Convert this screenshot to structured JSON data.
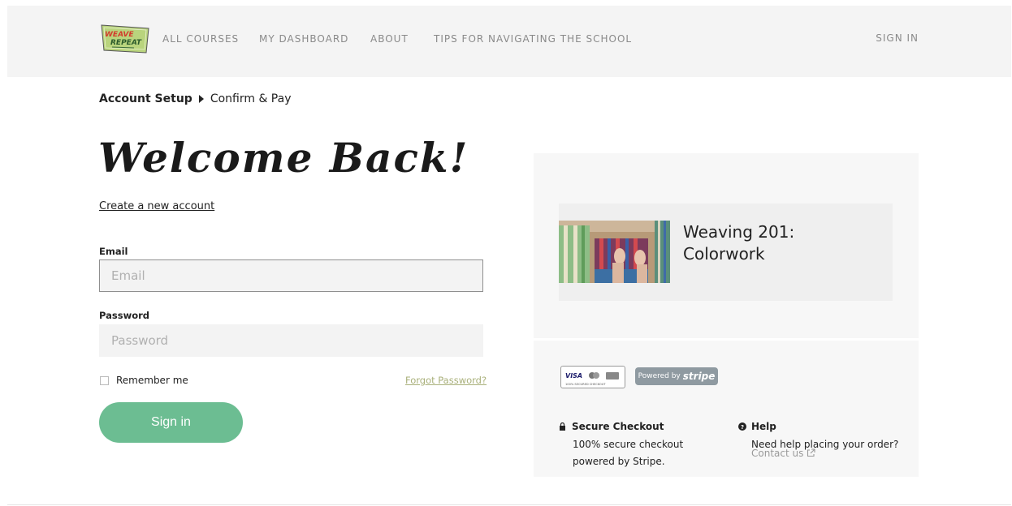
{
  "header": {
    "logo_top": "WEAVE",
    "logo_bottom": "REPEAT",
    "nav": [
      "ALL COURSES",
      "MY DASHBOARD",
      "ABOUT",
      "TIPS FOR NAVIGATING THE SCHOOL"
    ],
    "sign_in": "SIGN IN"
  },
  "breadcrumb": {
    "step1": "Account Setup",
    "step2": "Confirm & Pay"
  },
  "login": {
    "heading": "Welcome Back!",
    "create_account": "Create a new account",
    "email_label": "Email",
    "email_placeholder": "Email",
    "password_label": "Password",
    "password_placeholder": "Password",
    "remember_label": "Remember me",
    "forgot_label": "Forgot Password?",
    "submit_label": "Sign in"
  },
  "course": {
    "title": "Weaving 201: Colorwork"
  },
  "payment": {
    "badge_text": "100% SECURED CHECKOUT",
    "badge_visa": "VISA",
    "stripe_prefix": "Powered by",
    "stripe_brand": "stripe",
    "secure_title": "Secure Checkout",
    "secure_text": "100% secure checkout powered by Stripe.",
    "help_title": "Help",
    "help_text": "Need help placing your order?",
    "contact_label": "Contact us"
  },
  "colors": {
    "accent": "#6cbd92",
    "forgot_link": "#a9b07a",
    "topbar_bg": "#f4f4f4",
    "logo_bg": "#b9d47d"
  }
}
